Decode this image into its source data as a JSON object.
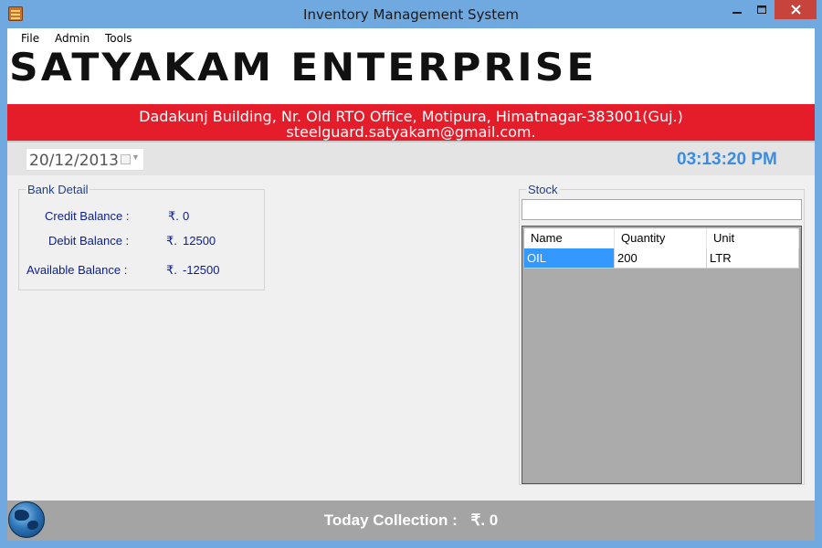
{
  "window": {
    "title": "Inventory Management System",
    "icon": "app-icon"
  },
  "menu": {
    "items": [
      "File",
      "Admin",
      "Tools"
    ]
  },
  "banner": {
    "title": "SATYAKAM ENTERPRISE",
    "address_line1": "Dadakunj Building, Nr. Old RTO Office, Motipura, Himatnagar-383001(Guj.)",
    "address_line2": "steelguard.satyakam@gmail.com."
  },
  "datebar": {
    "date": "20/12/2013",
    "time": "03:13:20 PM"
  },
  "bank_detail": {
    "title": "Bank Detail",
    "currency": "₹.",
    "credit_label": "Credit Balance   :",
    "credit_value": "0",
    "debit_label": "Debit Balance   :",
    "debit_value": "12500",
    "available_label": "Available Balance   :",
    "available_value": "-12500"
  },
  "stock": {
    "title": "Stock",
    "search_value": "",
    "columns": [
      "Name",
      "Quantity",
      "Unit"
    ],
    "rows": [
      [
        "OIL",
        "200",
        "LTR"
      ]
    ]
  },
  "status": {
    "collection_label": "Today Collection :",
    "collection_value": "₹.  0"
  },
  "colors": {
    "accent_red": "#e51d2a",
    "clock_blue": "#3a8de0",
    "selection_blue": "#3399ff"
  }
}
